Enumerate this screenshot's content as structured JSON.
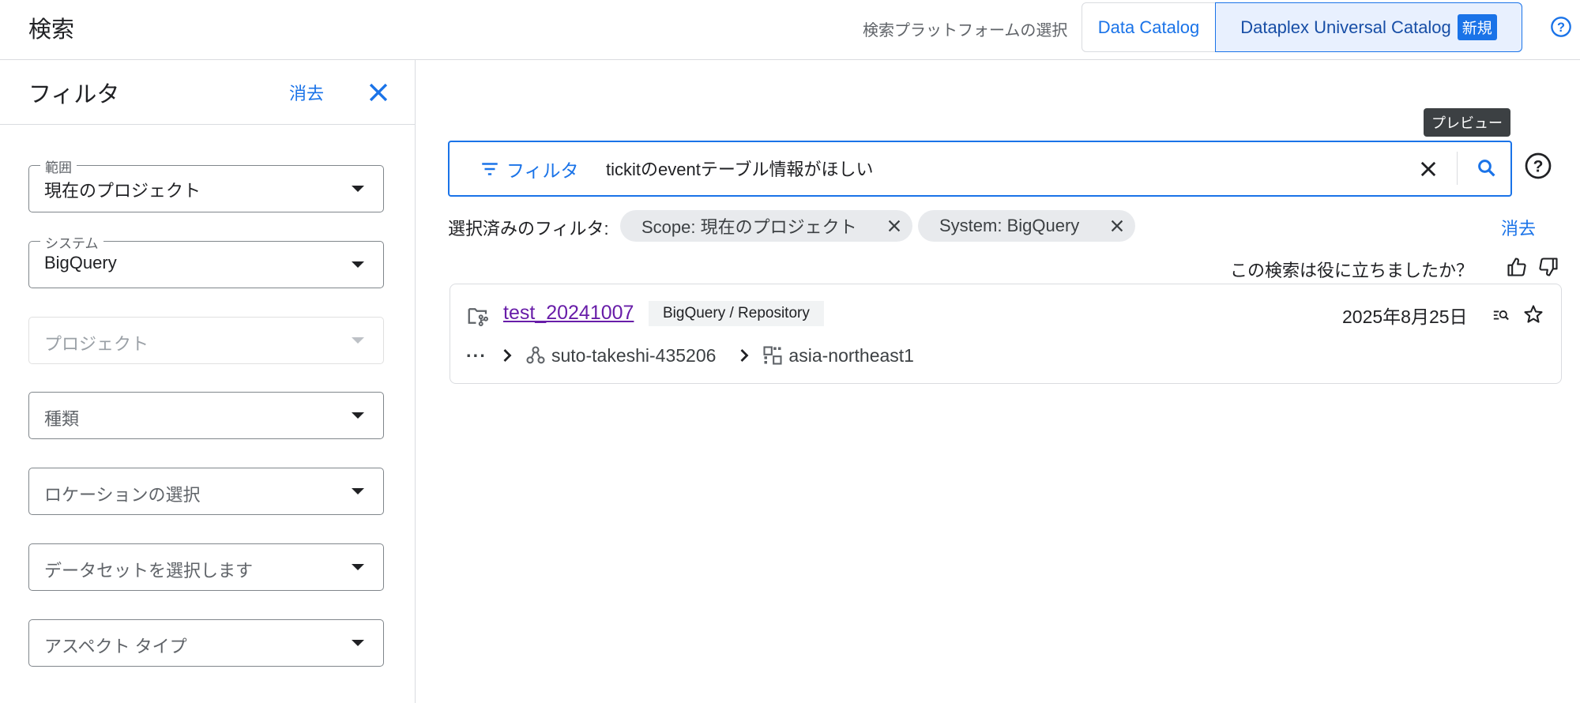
{
  "header": {
    "title": "検索",
    "platform_label": "検索プラットフォームの選択",
    "platforms": [
      {
        "label": "Data Catalog"
      },
      {
        "label": "Dataplex Universal Catalog",
        "badge": "新規",
        "selected": true
      }
    ],
    "help_icon": "help-circle-icon"
  },
  "filters": {
    "title": "フィルタ",
    "clear_label": "消去",
    "close_icon": "close-icon",
    "fields": [
      {
        "label": "範囲",
        "value": "現在のプロジェクト"
      },
      {
        "label": "システム",
        "value": "BigQuery"
      },
      {
        "placeholder": "プロジェクト",
        "disabled": true
      },
      {
        "placeholder": "種類"
      },
      {
        "placeholder": "ロケーションの選択"
      },
      {
        "placeholder": "データセットを選択します"
      },
      {
        "placeholder": "アスペクト タイプ"
      }
    ]
  },
  "search": {
    "tooltip": "プレビュー",
    "filter_button": "フィルタ",
    "query": "tickitのeventテーブル情報がほしい",
    "selected_filters_label": "選択済みのフィルタ:",
    "chips": [
      {
        "label": "Scope: 現在のプロジェクト"
      },
      {
        "label": "System: BigQuery"
      }
    ],
    "clear_label": "消去",
    "feedback_question": "この検索は役に立ちましたか？"
  },
  "results": [
    {
      "title": "test_20241007",
      "tag": "BigQuery / Repository",
      "date": "2025年8月25日",
      "breadcrumb": {
        "more": "···",
        "project": "suto-takeshi-435206",
        "location": "asia-northeast1"
      }
    }
  ],
  "colors": {
    "accent": "#1a73e8",
    "visited_link": "#681da8",
    "chip_bg": "#e8eaed",
    "selected_segment_bg": "#e8f0fe"
  }
}
